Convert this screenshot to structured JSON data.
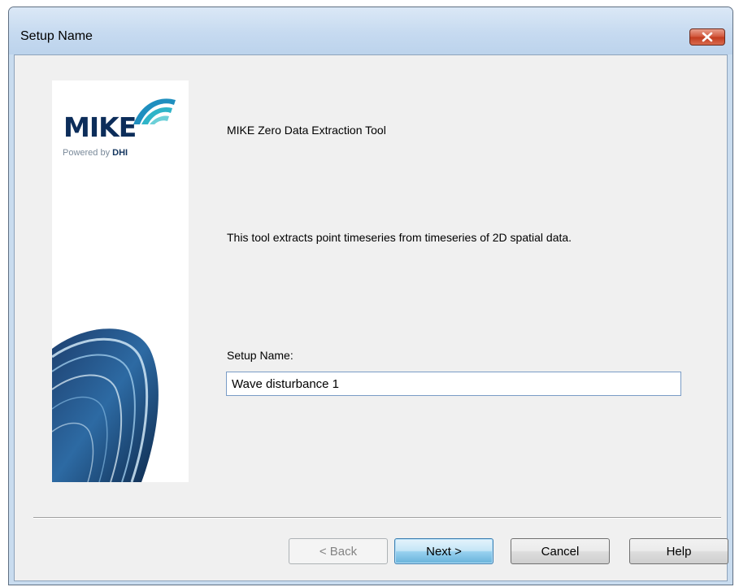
{
  "window": {
    "title": "Setup Name"
  },
  "branding": {
    "logo_text": "MIKE",
    "tagline_prefix": "Powered by",
    "tagline_brand": "DHI"
  },
  "content": {
    "intro": "MIKE Zero Data Extraction Tool",
    "description": "This tool extracts point timeseries from timeseries of 2D spatial data.",
    "field_label": "Setup Name:",
    "field_value": "Wave disturbance 1"
  },
  "buttons": {
    "back": "< Back",
    "next": "Next >",
    "cancel": "Cancel",
    "help": "Help"
  },
  "icons": {
    "close": "close-icon",
    "logo_swoosh": "dhi-swoosh-icon"
  },
  "colors": {
    "close_button": "#c84a2d",
    "default_button": "#98d1ef",
    "logo_navy": "#0c2d5a",
    "logo_teal": "#2fb4c8"
  }
}
